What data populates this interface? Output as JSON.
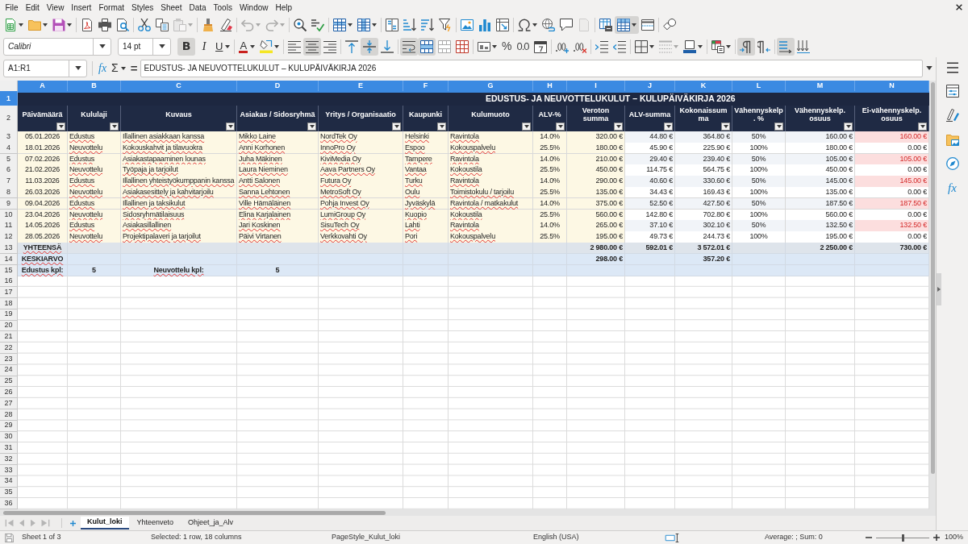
{
  "menu": [
    "File",
    "Edit",
    "View",
    "Insert",
    "Format",
    "Styles",
    "Sheet",
    "Data",
    "Tools",
    "Window",
    "Help"
  ],
  "standard_toolbar": {
    "paste": {
      "disabled": true
    },
    "undo": {
      "disabled": true
    },
    "redo": {
      "disabled": true
    },
    "headers_footers": {
      "disabled": true
    },
    "freeze_rows_and_columns": {
      "active": true
    }
  },
  "formatting_toolbar": {
    "font_name": "Calibri",
    "font_size": "14 pt",
    "bold": {
      "glyph": "B",
      "active": true
    },
    "italic": {
      "glyph": "I",
      "active": false
    },
    "underline": {
      "glyph": "U",
      "active": false
    },
    "font_color": "A",
    "align_left": {
      "active": false
    },
    "align_center": {
      "active": true
    },
    "align_right": {
      "active": false
    },
    "align_top": {
      "active": false
    },
    "align_middle": {
      "active": true
    },
    "align_bottom": {
      "active": false
    },
    "wrap_text": {
      "active": true
    },
    "merge_and_center": {
      "active": true
    },
    "percent": "%",
    "decimal": "0.0",
    "border_style": {
      "disabled": true
    },
    "paragraph_left_to_right": {
      "active": true
    },
    "paragraph_right_to_left": {
      "active": false
    },
    "text_left_to_right": {
      "active": true
    }
  },
  "formula_bar": {
    "name_box": "A1:R1",
    "function_wizard": "fx",
    "sum": "Σ",
    "equals": "=",
    "content": "EDUSTUS- JA NEUVOTTELUKULUT – KULUPÄIVÄKIRJA 2026"
  },
  "sheet": {
    "columns": [
      {
        "label": "A",
        "selected": true
      },
      {
        "label": "B",
        "selected": true
      },
      {
        "label": "C",
        "selected": true
      },
      {
        "label": "D",
        "selected": true
      },
      {
        "label": "E",
        "selected": true
      },
      {
        "label": "F",
        "selected": true
      },
      {
        "label": "G",
        "selected": true
      },
      {
        "label": "H",
        "selected": true
      },
      {
        "label": "I",
        "selected": true
      },
      {
        "label": "J",
        "selected": true
      },
      {
        "label": "K",
        "selected": true
      },
      {
        "label": "L",
        "selected": true
      },
      {
        "label": "M",
        "selected": true
      },
      {
        "label": "N",
        "selected": true
      }
    ],
    "row_headers": [
      {
        "label": "1",
        "selected": true
      },
      {
        "label": "2",
        "selected": false
      },
      {
        "label": "3",
        "selected": false
      },
      {
        "label": "4",
        "selected": false
      },
      {
        "label": "5",
        "selected": false
      },
      {
        "label": "6",
        "selected": false
      },
      {
        "label": "7",
        "selected": false
      },
      {
        "label": "8",
        "selected": false
      },
      {
        "label": "9",
        "selected": false
      },
      {
        "label": "10",
        "selected": false
      },
      {
        "label": "11",
        "selected": false
      },
      {
        "label": "12",
        "selected": false
      },
      {
        "label": "13",
        "selected": false
      },
      {
        "label": "14",
        "selected": false
      },
      {
        "label": "15",
        "selected": false
      },
      {
        "label": "16",
        "selected": false
      },
      {
        "label": "17",
        "selected": false
      },
      {
        "label": "18",
        "selected": false
      },
      {
        "label": "19",
        "selected": false
      },
      {
        "label": "20",
        "selected": false
      },
      {
        "label": "21",
        "selected": false
      },
      {
        "label": "22",
        "selected": false
      },
      {
        "label": "23",
        "selected": false
      },
      {
        "label": "24",
        "selected": false
      },
      {
        "label": "25",
        "selected": false
      },
      {
        "label": "26",
        "selected": false
      },
      {
        "label": "27",
        "selected": false
      },
      {
        "label": "28",
        "selected": false
      },
      {
        "label": "29",
        "selected": false
      },
      {
        "label": "30",
        "selected": false
      },
      {
        "label": "31",
        "selected": false
      },
      {
        "label": "32",
        "selected": false
      },
      {
        "label": "33",
        "selected": false
      },
      {
        "label": "34",
        "selected": false
      },
      {
        "label": "35",
        "selected": false
      },
      {
        "label": "36",
        "selected": false
      }
    ],
    "title": "EDUSTUS- JA NEUVOTTELUKULUT – KULUPÄIVÄKIRJA 2026",
    "headers": [
      "Päivämäärä",
      "Kululaji",
      "Kuvaus",
      "Asiakas / Sidosryhmä",
      "Yritys / Organisaatio",
      "Kaupunki",
      "Kulumuoto",
      "ALV-%",
      "Veroton summa",
      "ALV-summa",
      "Kokonaissumma",
      "Vähennyskelp. %",
      "Vähennyskelp. osuus",
      "Ei-vähennyskelp. osuus"
    ],
    "data_rows": [
      {
        "cells": [
          "05.01.2026",
          "Edustus",
          "Illallinen asiakkaan kanssa",
          "Mikko Laine",
          "NordTek Oy",
          "Helsinki",
          "Ravintola",
          "14.0%",
          "320.00 €",
          "44.80 €",
          "364.80 €",
          "50%",
          "160.00 €",
          "160.00 €"
        ],
        "flagged": true
      },
      {
        "cells": [
          "18.01.2026",
          "Neuvottelu",
          "Kokouskahvit ja tilavuokra",
          "Anni Korhonen",
          "InnoPro Oy",
          "Espoo",
          "Kokouspalvelu",
          "25.5%",
          "180.00 €",
          "45.90 €",
          "225.90 €",
          "100%",
          "180.00 €",
          "0.00 €"
        ],
        "flagged": false
      },
      {
        "cells": [
          "07.02.2026",
          "Edustus",
          "Asiakastapaaminen lounas",
          "Juha Mäkinen",
          "KiviMedia Oy",
          "Tampere",
          "Ravintola",
          "14.0%",
          "210.00 €",
          "29.40 €",
          "239.40 €",
          "50%",
          "105.00 €",
          "105.00 €"
        ],
        "flagged": true
      },
      {
        "cells": [
          "21.02.2026",
          "Neuvottelu",
          "Työpaja ja tarjoilut",
          "Laura Nieminen",
          "Aava Partners Oy",
          "Vantaa",
          "Kokoustila",
          "25.5%",
          "450.00 €",
          "114.75 €",
          "564.75 €",
          "100%",
          "450.00 €",
          "0.00 €"
        ],
        "flagged": false
      },
      {
        "cells": [
          "11.03.2026",
          "Edustus",
          "Illallinen yhteistyökumppanin kanssa",
          "Antti Salonen",
          "Futura Oy",
          "Turku",
          "Ravintola",
          "14.0%",
          "290.00 €",
          "40.60 €",
          "330.60 €",
          "50%",
          "145.00 €",
          "145.00 €"
        ],
        "flagged": true
      },
      {
        "cells": [
          "26.03.2026",
          "Neuvottelu",
          "Asiakasesittely ja kahvitarjoilu",
          "Sanna Lehtonen",
          "MetroSoft Oy",
          "Oulu",
          "Toimistokulu / tarjoilu",
          "25.5%",
          "135.00 €",
          "34.43 €",
          "169.43 €",
          "100%",
          "135.00 €",
          "0.00 €"
        ],
        "flagged": false
      },
      {
        "cells": [
          "09.04.2026",
          "Edustus",
          "Illallinen ja taksikulut",
          "Ville Hämäläinen",
          "Pohja Invest Oy",
          "Jyväskylä",
          "Ravintola / matkakulut",
          "14.0%",
          "375.00 €",
          "52.50 €",
          "427.50 €",
          "50%",
          "187.50 €",
          "187.50 €"
        ],
        "flagged": true
      },
      {
        "cells": [
          "23.04.2026",
          "Neuvottelu",
          "Sidosryhmätilaisuus",
          "Elina Karjalainen",
          "LumiGroup Oy",
          "Kuopio",
          "Kokoustila",
          "25.5%",
          "560.00 €",
          "142.80 €",
          "702.80 €",
          "100%",
          "560.00 €",
          "0.00 €"
        ],
        "flagged": false
      },
      {
        "cells": [
          "14.05.2026",
          "Edustus",
          "Asiakasillallinen",
          "Jari Koskinen",
          "SisuTech Oy",
          "Lahti",
          "Ravintola",
          "14.0%",
          "265.00 €",
          "37.10 €",
          "302.10 €",
          "50%",
          "132.50 €",
          "132.50 €"
        ],
        "flagged": true
      },
      {
        "cells": [
          "28.05.2026",
          "Neuvottelu",
          "Projektipalaveri ja tarjoilut",
          "Päivi Virtanen",
          "Verkkovahti Oy",
          "Pori",
          "Kokouspalvelu",
          "25.5%",
          "195.00 €",
          "49.73 €",
          "244.73 €",
          "100%",
          "195.00 €",
          "0.00 €"
        ],
        "flagged": false
      }
    ],
    "totals_row": {
      "label": "YHTEENSÄ",
      "veroton_summa": "2 980.00 €",
      "alv_summa": "592.01 €",
      "kokonaissumma": "3 572.01 €",
      "vahennyskelpoinen_osuus": "2 250.00 €",
      "ei_vahennyskelpoinen_osuus": "730.00 €"
    },
    "average_row": {
      "label": "KESKIARVO",
      "veroton_summa": "298.00 €",
      "kokonaissumma": "357.20 €"
    },
    "count_row": {
      "edustus_label": "Edustus kpl:",
      "edustus_count": "5",
      "neuvottelu_label": "Neuvottelu kpl:",
      "neuvottelu_count": "5"
    }
  },
  "sheet_tabs": [
    {
      "label": "Kulut_loki",
      "selected": true
    },
    {
      "label": "Yhteenveto",
      "selected": false
    },
    {
      "label": "Ohjeet_ja_Alv",
      "selected": false
    }
  ],
  "status_bar": {
    "sheet": "Sheet 1 of 3",
    "selection": "Selected: 1 row, 18 columns",
    "page_style": "PageStyle_Kulut_loki",
    "language": "English (USA)",
    "statistics": "Average: ; Sum: 0",
    "zoom": {
      "level": 0.5,
      "reading": "100%"
    }
  },
  "sidebar": {
    "functions": "fx"
  }
}
